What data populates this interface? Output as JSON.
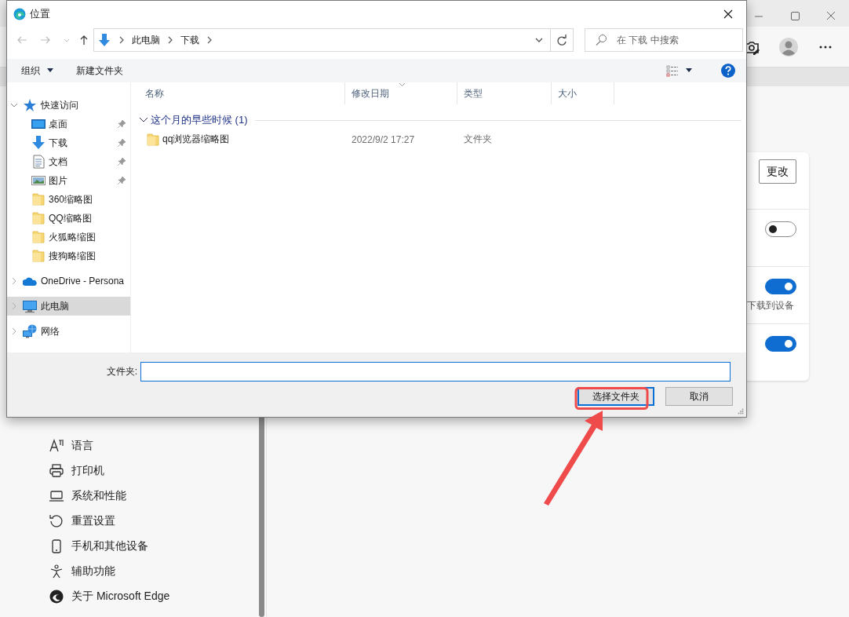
{
  "settings_nav": {
    "items": [
      {
        "label": "语言",
        "kind": "language"
      },
      {
        "label": "打印机",
        "kind": "printer"
      },
      {
        "label": "系统和性能",
        "kind": "laptop"
      },
      {
        "label": "重置设置",
        "kind": "reset"
      },
      {
        "label": "手机和其他设备",
        "kind": "phone"
      },
      {
        "label": "辅助功能",
        "kind": "accessibility"
      },
      {
        "label": "关于 Microsoft Edge",
        "kind": "edge"
      }
    ]
  },
  "settings_card": {
    "button": "更改",
    "rows": [
      {
        "on": false
      },
      {
        "on": true,
        "description": "下载到设备"
      },
      {
        "on": true
      }
    ]
  },
  "dialog": {
    "title": "位置",
    "breadcrumb": [
      "此电脑",
      "下载"
    ],
    "search": {
      "placeholder": "在 下载 中搜索"
    },
    "toolbar": {
      "organize": "组织",
      "new_folder": "新建文件夹"
    },
    "nav": {
      "items": [
        {
          "label": "快速访问",
          "kind": "star",
          "expanded": true,
          "selected": false,
          "children": [
            {
              "label": "桌面",
              "kind": "desktop",
              "pinned": true,
              "selected": false
            },
            {
              "label": "下载",
              "kind": "download",
              "pinned": true,
              "selected": false
            },
            {
              "label": "文档",
              "kind": "document",
              "pinned": true,
              "selected": false
            },
            {
              "label": "图片",
              "kind": "pictures",
              "pinned": true,
              "selected": false
            },
            {
              "label": "360缩略图",
              "kind": "folder",
              "pinned": false,
              "selected": false
            },
            {
              "label": "QQ缩略图",
              "kind": "folder",
              "pinned": false,
              "selected": false
            },
            {
              "label": "火狐略缩图",
              "kind": "folder",
              "pinned": false,
              "selected": false
            },
            {
              "label": "搜狗略缩图",
              "kind": "folder",
              "pinned": false,
              "selected": false
            }
          ]
        },
        {
          "label": "OneDrive - Persona",
          "kind": "cloud",
          "expanded": false,
          "selected": false
        },
        {
          "label": "此电脑",
          "kind": "computer",
          "expanded": false,
          "selected": true
        },
        {
          "label": "网络",
          "kind": "network",
          "expanded": false,
          "selected": false
        }
      ]
    },
    "columns": [
      "名称",
      "修改日期",
      "类型",
      "大小"
    ],
    "groups": [
      {
        "label": "这个月的早些时候 (1)",
        "expanded": true,
        "rows": [
          {
            "name": "qq浏览器缩略图",
            "date": "2022/9/2 17:27",
            "type": "文件夹"
          }
        ]
      }
    ],
    "folder_field": {
      "label": "文件夹:"
    },
    "buttons": [
      {
        "label": "选择文件夹",
        "kind": "primary"
      },
      {
        "label": "取消",
        "kind": "normal"
      }
    ]
  }
}
